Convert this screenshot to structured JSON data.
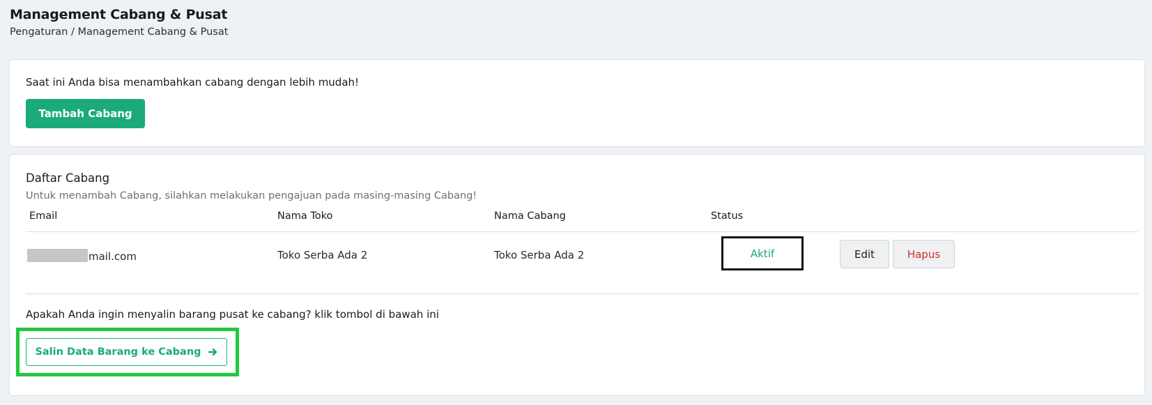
{
  "page": {
    "title": "Management Cabang & Pusat",
    "breadcrumb": "Pengaturan / Management Cabang & Pusat"
  },
  "promo": {
    "text": "Saat ini Anda bisa menambahkan cabang dengan lebih mudah!",
    "add_button": "Tambah Cabang"
  },
  "branches": {
    "title": "Daftar Cabang",
    "subtitle": "Untuk menambah Cabang, silahkan melakukan pengajuan pada masing-masing Cabang!",
    "columns": [
      "Email",
      "Nama Toko",
      "Nama Cabang",
      "Status"
    ],
    "rows": [
      {
        "email_visible": "mail.com",
        "store_name": "Toko Serba Ada 2",
        "branch_name": "Toko Serba Ada 2",
        "status": "Aktif",
        "edit_label": "Edit",
        "delete_label": "Hapus"
      }
    ]
  },
  "copy": {
    "text": "Apakah Anda ingin menyalin barang pusat ke cabang? klik tombol di bawah ini",
    "button_label": "Salin Data Barang ke Cabang",
    "button_icon": "arrow-right-icon"
  },
  "colors": {
    "accent": "#1baa7b",
    "danger": "#d32f2f",
    "highlight": "#21c93f",
    "background": "#eff2f5"
  }
}
